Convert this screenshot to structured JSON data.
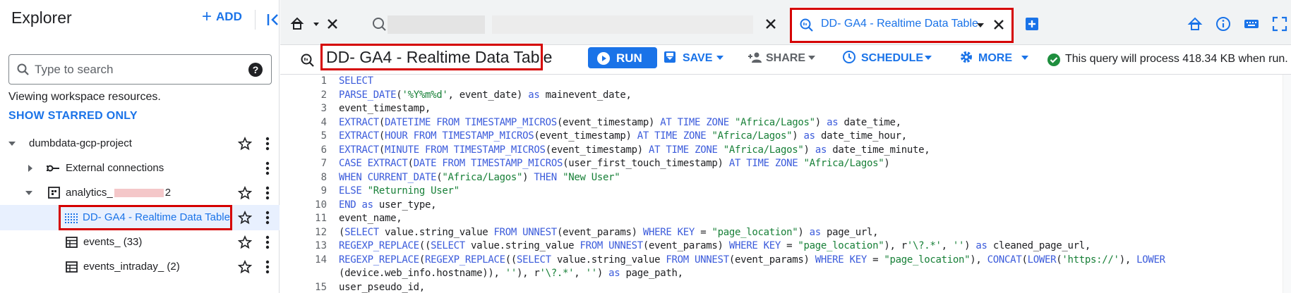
{
  "explorer": {
    "title": "Explorer",
    "add_label": "ADD",
    "search_placeholder": "Type to search",
    "viewing_text": "Viewing workspace resources.",
    "starred_label": "SHOW STARRED ONLY",
    "tree": {
      "project": "dumbdata-gcp-project",
      "external": "External connections",
      "dataset_prefix": "analytics_",
      "dataset_suffix": "2",
      "view": "DD- GA4 - Realtime Data Table",
      "events": "events_ (33)",
      "intraday": "events_intraday_ (2)"
    }
  },
  "tabs": {
    "active_label": "DD- GA4 - Realtime Data Table"
  },
  "toolbar": {
    "query_title": "DD- GA4 - Realtime Data Table",
    "run": "RUN",
    "save": "SAVE",
    "share": "SHARE",
    "schedule": "SCHEDULE",
    "more": "MORE",
    "status": "This query will process 418.34 KB when run."
  },
  "colors": {
    "accent": "#1a73e8",
    "highlight": "#d50000",
    "success": "#1e8e3e"
  },
  "editor": {
    "line_numbers": [
      "1",
      "2",
      "3",
      "4",
      "5",
      "6",
      "7",
      "8",
      "9",
      "10",
      "11",
      "12",
      "13",
      "14",
      "",
      "15"
    ],
    "lines": [
      [
        [
          "k",
          "SELECT"
        ]
      ],
      [
        [
          "k",
          "PARSE_DATE"
        ],
        [
          "t",
          "("
        ],
        [
          "s",
          "'%Y%m%d'"
        ],
        [
          "t",
          ", event_date) "
        ],
        [
          "k",
          "as"
        ],
        [
          "t",
          " mainevent_date,"
        ]
      ],
      [
        [
          "t",
          "event_timestamp,"
        ]
      ],
      [
        [
          "k",
          "EXTRACT"
        ],
        [
          "t",
          "("
        ],
        [
          "k",
          "DATETIME"
        ],
        [
          "t",
          " "
        ],
        [
          "k",
          "FROM"
        ],
        [
          "t",
          " "
        ],
        [
          "k",
          "TIMESTAMP_MICROS"
        ],
        [
          "t",
          "(event_timestamp) "
        ],
        [
          "k",
          "AT"
        ],
        [
          "t",
          " "
        ],
        [
          "k",
          "TIME"
        ],
        [
          "t",
          " "
        ],
        [
          "k",
          "ZONE"
        ],
        [
          "t",
          " "
        ],
        [
          "s",
          "\"Africa/Lagos\""
        ],
        [
          "t",
          ") "
        ],
        [
          "k",
          "as"
        ],
        [
          "t",
          " date_time,"
        ]
      ],
      [
        [
          "k",
          "EXTRACT"
        ],
        [
          "t",
          "("
        ],
        [
          "k",
          "HOUR"
        ],
        [
          "t",
          " "
        ],
        [
          "k",
          "FROM"
        ],
        [
          "t",
          " "
        ],
        [
          "k",
          "TIMESTAMP_MICROS"
        ],
        [
          "t",
          "(event_timestamp) "
        ],
        [
          "k",
          "AT"
        ],
        [
          "t",
          " "
        ],
        [
          "k",
          "TIME"
        ],
        [
          "t",
          " "
        ],
        [
          "k",
          "ZONE"
        ],
        [
          "t",
          " "
        ],
        [
          "s",
          "\"Africa/Lagos\""
        ],
        [
          "t",
          ") "
        ],
        [
          "k",
          "as"
        ],
        [
          "t",
          " date_time_hour,"
        ]
      ],
      [
        [
          "k",
          "EXTRACT"
        ],
        [
          "t",
          "("
        ],
        [
          "k",
          "MINUTE"
        ],
        [
          "t",
          " "
        ],
        [
          "k",
          "FROM"
        ],
        [
          "t",
          " "
        ],
        [
          "k",
          "TIMESTAMP_MICROS"
        ],
        [
          "t",
          "(event_timestamp) "
        ],
        [
          "k",
          "AT"
        ],
        [
          "t",
          " "
        ],
        [
          "k",
          "TIME"
        ],
        [
          "t",
          " "
        ],
        [
          "k",
          "ZONE"
        ],
        [
          "t",
          " "
        ],
        [
          "s",
          "\"Africa/Lagos\""
        ],
        [
          "t",
          ") "
        ],
        [
          "k",
          "as"
        ],
        [
          "t",
          " date_time_minute,"
        ]
      ],
      [
        [
          "k",
          "CASE"
        ],
        [
          "t",
          " "
        ],
        [
          "k",
          "EXTRACT"
        ],
        [
          "t",
          "("
        ],
        [
          "k",
          "DATE"
        ],
        [
          "t",
          " "
        ],
        [
          "k",
          "FROM"
        ],
        [
          "t",
          " "
        ],
        [
          "k",
          "TIMESTAMP_MICROS"
        ],
        [
          "t",
          "(user_first_touch_timestamp) "
        ],
        [
          "k",
          "AT"
        ],
        [
          "t",
          " "
        ],
        [
          "k",
          "TIME"
        ],
        [
          "t",
          " "
        ],
        [
          "k",
          "ZONE"
        ],
        [
          "t",
          " "
        ],
        [
          "s",
          "\"Africa/Lagos\""
        ],
        [
          "t",
          ")"
        ]
      ],
      [
        [
          "k",
          "WHEN"
        ],
        [
          "t",
          " "
        ],
        [
          "k",
          "CURRENT_DATE"
        ],
        [
          "t",
          "("
        ],
        [
          "s",
          "\"Africa/Lagos\""
        ],
        [
          "t",
          ") "
        ],
        [
          "k",
          "THEN"
        ],
        [
          "t",
          " "
        ],
        [
          "s",
          "\"New User\""
        ]
      ],
      [
        [
          "k",
          "ELSE"
        ],
        [
          "t",
          " "
        ],
        [
          "s",
          "\"Returning User\""
        ]
      ],
      [
        [
          "k",
          "END"
        ],
        [
          "t",
          " "
        ],
        [
          "k",
          "as"
        ],
        [
          "t",
          " user_type,"
        ]
      ],
      [
        [
          "t",
          "event_name,"
        ]
      ],
      [
        [
          "t",
          "("
        ],
        [
          "k",
          "SELECT"
        ],
        [
          "t",
          " value.string_value "
        ],
        [
          "k",
          "FROM"
        ],
        [
          "t",
          " "
        ],
        [
          "k",
          "UNNEST"
        ],
        [
          "t",
          "(event_params) "
        ],
        [
          "k",
          "WHERE"
        ],
        [
          "t",
          " "
        ],
        [
          "k",
          "KEY"
        ],
        [
          "t",
          " = "
        ],
        [
          "s",
          "\"page_location\""
        ],
        [
          "t",
          ") "
        ],
        [
          "k",
          "as"
        ],
        [
          "t",
          " page_url,"
        ]
      ],
      [
        [
          "k",
          "REGEXP_REPLACE"
        ],
        [
          "t",
          "(("
        ],
        [
          "k",
          "SELECT"
        ],
        [
          "t",
          " value.string_value "
        ],
        [
          "k",
          "FROM"
        ],
        [
          "t",
          " "
        ],
        [
          "k",
          "UNNEST"
        ],
        [
          "t",
          "(event_params) "
        ],
        [
          "k",
          "WHERE"
        ],
        [
          "t",
          " "
        ],
        [
          "k",
          "KEY"
        ],
        [
          "t",
          " = "
        ],
        [
          "s",
          "\"page_location\""
        ],
        [
          "t",
          "), r"
        ],
        [
          "s",
          "'\\?.*'"
        ],
        [
          "t",
          ", "
        ],
        [
          "s",
          "''"
        ],
        [
          "t",
          ") "
        ],
        [
          "k",
          "as"
        ],
        [
          "t",
          " cleaned_page_url,"
        ]
      ],
      [
        [
          "k",
          "REGEXP_REPLACE"
        ],
        [
          "t",
          "("
        ],
        [
          "k",
          "REGEXP_REPLACE"
        ],
        [
          "t",
          "(("
        ],
        [
          "k",
          "SELECT"
        ],
        [
          "t",
          " value.string_value "
        ],
        [
          "k",
          "FROM"
        ],
        [
          "t",
          " "
        ],
        [
          "k",
          "UNNEST"
        ],
        [
          "t",
          "(event_params) "
        ],
        [
          "k",
          "WHERE"
        ],
        [
          "t",
          " "
        ],
        [
          "k",
          "KEY"
        ],
        [
          "t",
          " = "
        ],
        [
          "s",
          "\"page_location\""
        ],
        [
          "t",
          "), "
        ],
        [
          "k",
          "CONCAT"
        ],
        [
          "t",
          "("
        ],
        [
          "k",
          "LOWER"
        ],
        [
          "t",
          "("
        ],
        [
          "s",
          "'https://'"
        ],
        [
          "t",
          "), "
        ],
        [
          "k",
          "LOWER"
        ]
      ],
      [
        [
          "t",
          "(device.web_info.hostname)), "
        ],
        [
          "s",
          "''"
        ],
        [
          "t",
          "), r"
        ],
        [
          "s",
          "'\\?.*'"
        ],
        [
          "t",
          ", "
        ],
        [
          "s",
          "''"
        ],
        [
          "t",
          ") "
        ],
        [
          "k",
          "as"
        ],
        [
          "t",
          " page_path,"
        ]
      ],
      [
        [
          "t",
          "user_pseudo_id,"
        ]
      ]
    ]
  }
}
